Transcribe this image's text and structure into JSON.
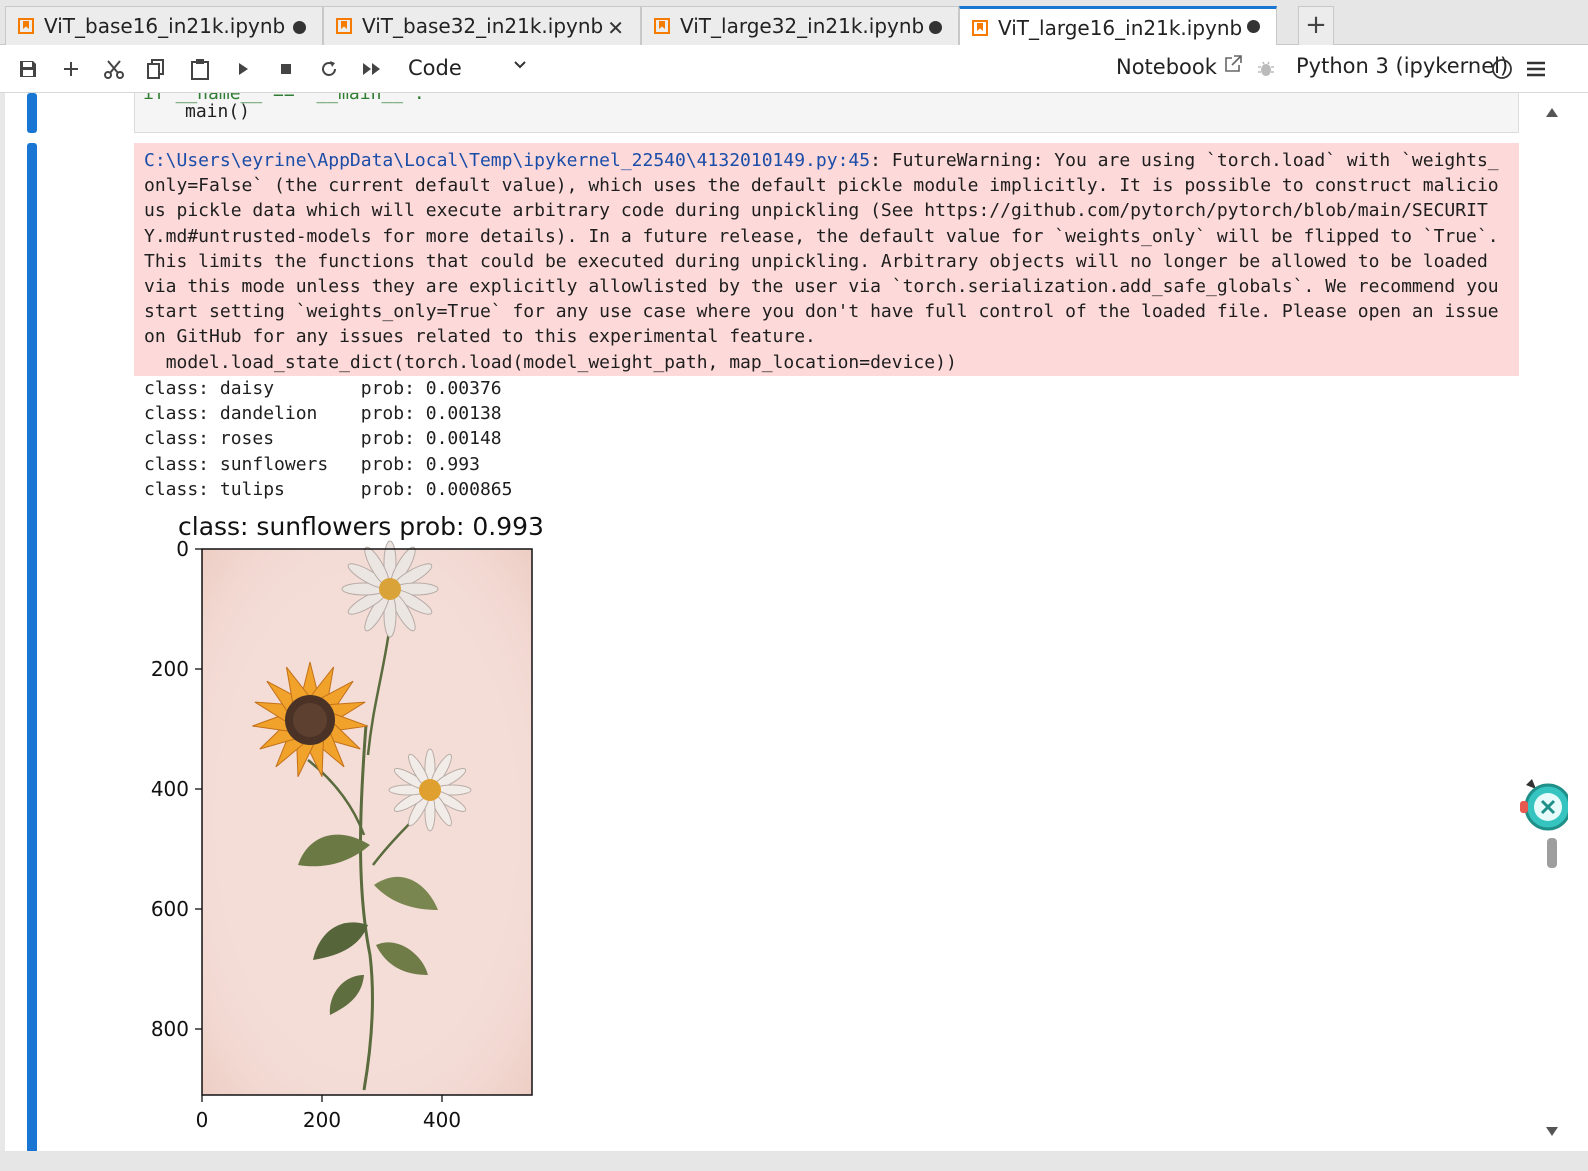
{
  "tabs": [
    {
      "label": "ViT_base16_in21k.ipynb",
      "state": "dirty"
    },
    {
      "label": "ViT_base32_in21k.ipynb",
      "state": "close"
    },
    {
      "label": "ViT_large32_in21k.ipynb",
      "state": "dirty"
    },
    {
      "label": "ViT_large16_in21k.ipynb",
      "state": "dirty",
      "active": true
    }
  ],
  "tab_close_glyph": "✕",
  "add_tab_label": "+",
  "toolbar": {
    "icons": [
      "save-icon",
      "add-cell-icon",
      "cut-icon",
      "copy-icon",
      "paste-icon",
      "run-icon",
      "stop-icon",
      "restart-icon",
      "run-all-icon"
    ],
    "cell_type": "Code",
    "notebook_link": "Notebook",
    "kernel": "Python 3 (ipykernel)"
  },
  "cell": {
    "code_partial_top": "if __name__ == '__main__':",
    "code_line": "main()"
  },
  "stderr": {
    "path": "C:\\Users\\eyrine\\AppData\\Local\\Temp\\ipykernel_22540\\4132010149.py:45",
    "message": ": FutureWarning: You are using `torch.load` with `weights_only=False` (the current default value), which uses the default pickle module implicitly. It is possible to construct malicious pickle data which will execute arbitrary code during unpickling (See https://github.com/pytorch/pytorch/blob/main/SECURITY.md#untrusted-models for more details). In a future release, the default value for `weights_only` will be flipped to `True`. This limits the functions that could be executed during unpickling. Arbitrary objects will no longer be allowed to be loaded via this mode unless they are explicitly allowlisted by the user via `torch.serialization.add_safe_globals`. We recommend you start setting `weights_only=True` for any use case where you don't have full control of the loaded file. Please open an issue on GitHub for any issues related to this experimental feature.",
    "code": "  model.load_state_dict(torch.load(model_weight_path, map_location=device))"
  },
  "stdout": [
    "class: daisy        prob: 0.00376",
    "class: dandelion    prob: 0.00138",
    "class: roses        prob: 0.00148",
    "class: sunflowers   prob: 0.993",
    "class: tulips       prob: 0.000865"
  ],
  "plot": {
    "title": "class: sunflowers   prob: 0.993",
    "y_ticks": [
      "0",
      "200",
      "400",
      "600",
      "800"
    ],
    "x_ticks": [
      "0",
      "200",
      "400"
    ],
    "image_width": 550,
    "image_height": 910,
    "background_color": "#f4ddd7"
  },
  "colors": {
    "accent": "#1976d2",
    "stderr_bg": "#fdd9d9",
    "path": "#1a4da8",
    "notebook_icon": "#f57c00"
  }
}
